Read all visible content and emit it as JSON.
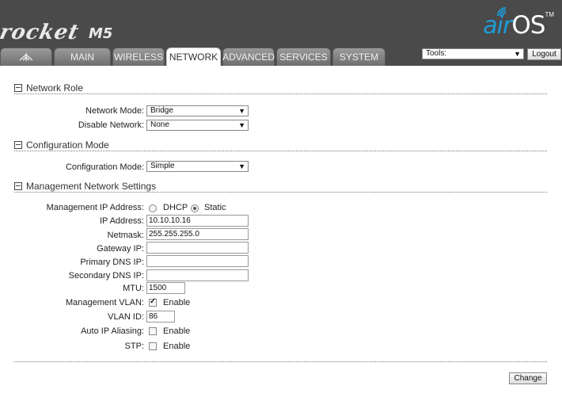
{
  "header": {
    "product": "rocket",
    "model": "M5",
    "os_brand_air": "air",
    "os_brand_os": "OS",
    "os_tm": "TM"
  },
  "tabs": [
    {
      "label": "",
      "icon": "ubiquiti-logo-icon"
    },
    {
      "label": "MAIN"
    },
    {
      "label": "WIRELESS"
    },
    {
      "label": "NETWORK",
      "active": true
    },
    {
      "label": "ADVANCED"
    },
    {
      "label": "SERVICES"
    },
    {
      "label": "SYSTEM"
    }
  ],
  "toolbar": {
    "tools_selected": "Tools:",
    "logout_label": "Logout"
  },
  "network_role": {
    "title": "Network Role",
    "network_mode_label": "Network Mode:",
    "network_mode_value": "Bridge",
    "disable_network_label": "Disable Network:",
    "disable_network_value": "None"
  },
  "configuration_mode": {
    "title": "Configuration Mode",
    "label": "Configuration Mode:",
    "value": "Simple"
  },
  "management": {
    "title": "Management Network Settings",
    "ip_address_mode_label": "Management IP Address:",
    "dhcp_label": "DHCP",
    "static_label": "Static",
    "ip_mode_selected": "Static",
    "ip_address_label": "IP Address:",
    "ip_address_value": "10.10.10.16",
    "netmask_label": "Netmask:",
    "netmask_value": "255.255.255.0",
    "gateway_label": "Gateway IP:",
    "gateway_value": "",
    "primary_dns_label": "Primary DNS IP:",
    "primary_dns_value": "",
    "secondary_dns_label": "Secondary DNS IP:",
    "secondary_dns_value": "",
    "mtu_label": "MTU:",
    "mtu_value": "1500",
    "vlan_label": "Management VLAN:",
    "vlan_enable_label": "Enable",
    "vlan_enabled": true,
    "vlan_id_label": "VLAN ID:",
    "vlan_id_value": "86",
    "auto_ip_label": "Auto IP Aliasing:",
    "auto_ip_enable_label": "Enable",
    "auto_ip_enabled": false,
    "stp_label": "STP:",
    "stp_enable_label": "Enable",
    "stp_enabled": false
  },
  "actions": {
    "change_label": "Change"
  },
  "colors": {
    "header_bg": "#4a4a4a",
    "airos_blue": "#1e9bd7"
  }
}
